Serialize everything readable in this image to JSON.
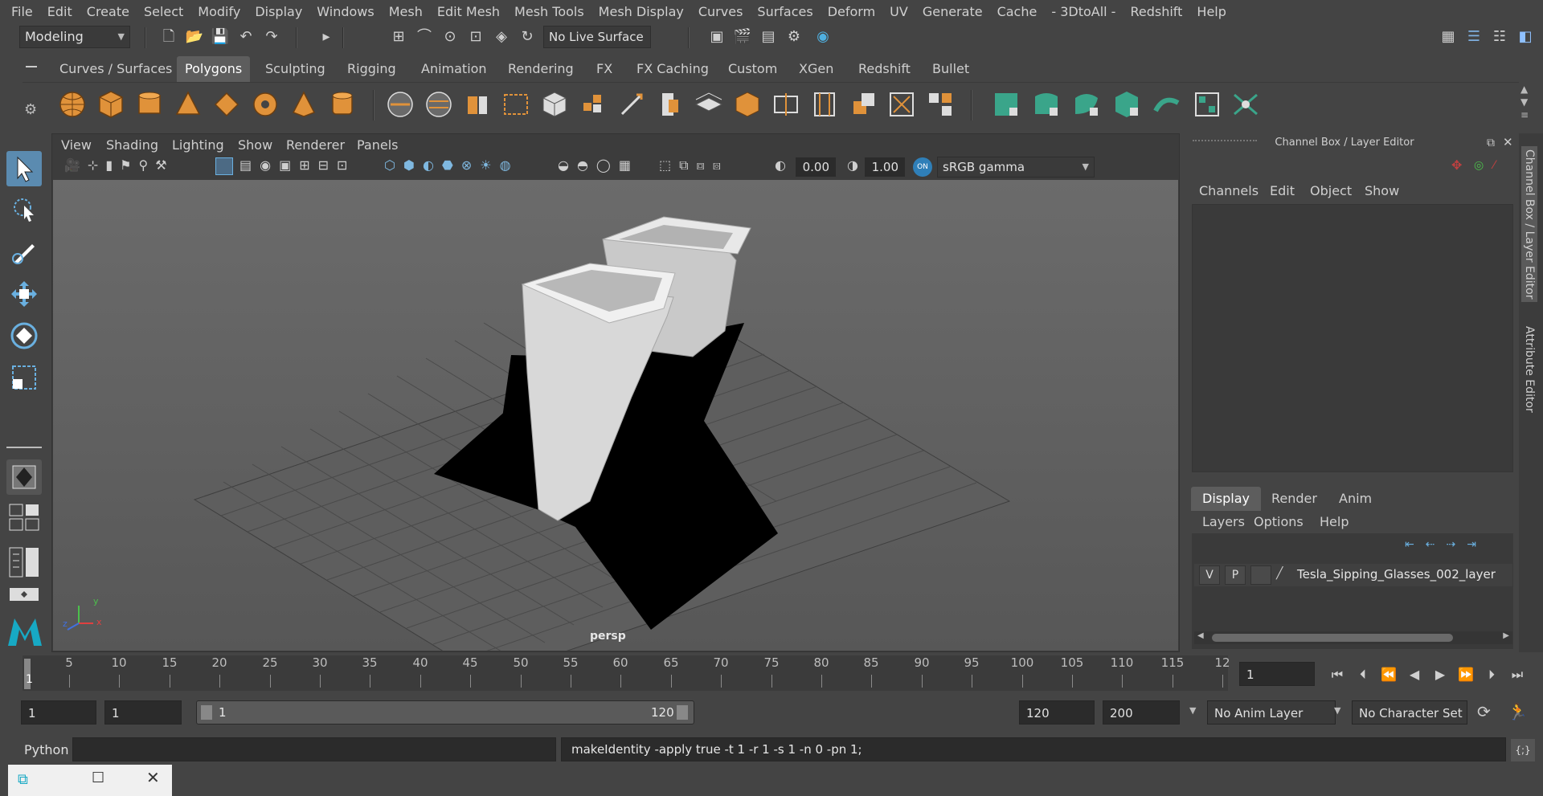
{
  "menubar": [
    "File",
    "Edit",
    "Create",
    "Select",
    "Modify",
    "Display",
    "Windows",
    "Mesh",
    "Edit Mesh",
    "Mesh Tools",
    "Mesh Display",
    "Curves",
    "Surfaces",
    "Deform",
    "UV",
    "Generate",
    "Cache",
    "- 3DtoAll -",
    "Redshift",
    "Help"
  ],
  "status": {
    "mode": "Modeling",
    "live_surface": "No Live Surface"
  },
  "shelf_tabs": [
    "Curves / Surfaces",
    "Polygons",
    "Sculpting",
    "Rigging",
    "Animation",
    "Rendering",
    "FX",
    "FX Caching",
    "Custom",
    "XGen",
    "Redshift",
    "Bullet"
  ],
  "shelf_active": "Polygons",
  "panel_menu": [
    "View",
    "Shading",
    "Lighting",
    "Show",
    "Renderer",
    "Panels"
  ],
  "viewport": {
    "exposure": "0.00",
    "gamma": "1.00",
    "color_space": "sRGB gamma",
    "camera_label": "persp",
    "axis_x": "x",
    "axis_y": "y",
    "axis_z": "z"
  },
  "channel_box": {
    "title": "Channel Box / Layer Editor",
    "menu": [
      "Channels",
      "Edit",
      "Object",
      "Show"
    ],
    "layer_tabs": [
      "Display",
      "Render",
      "Anim"
    ],
    "layer_menu": [
      "Layers",
      "Options",
      "Help"
    ],
    "layer": {
      "v": "V",
      "p": "P",
      "name": "Tesla_Sipping_Glasses_002_layer"
    }
  },
  "side_tabs": [
    "Channel Box / Layer Editor",
    "Attribute Editor"
  ],
  "timeline": {
    "ticks": [
      "5",
      "10",
      "15",
      "20",
      "25",
      "30",
      "35",
      "40",
      "45",
      "50",
      "55",
      "60",
      "65",
      "70",
      "75",
      "80",
      "85",
      "90",
      "95",
      "100",
      "105",
      "110",
      "115",
      "12"
    ],
    "start_marker": "1",
    "current_frame": "1"
  },
  "range": {
    "start": "1",
    "start2": "1",
    "slider_start": "1",
    "slider_end": "120",
    "end": "120",
    "end2": "200",
    "anim_layer": "No Anim Layer",
    "char_set": "No Character Set"
  },
  "command": {
    "lang": "Python",
    "output": "makeIdentity -apply true -t 1 -r 1 -s 1 -n 0 -pn 1;"
  },
  "colors": {
    "accent": "#5b8bb0",
    "shelf_orange": "#e0923a",
    "shelf_teal": "#3aa58a"
  }
}
